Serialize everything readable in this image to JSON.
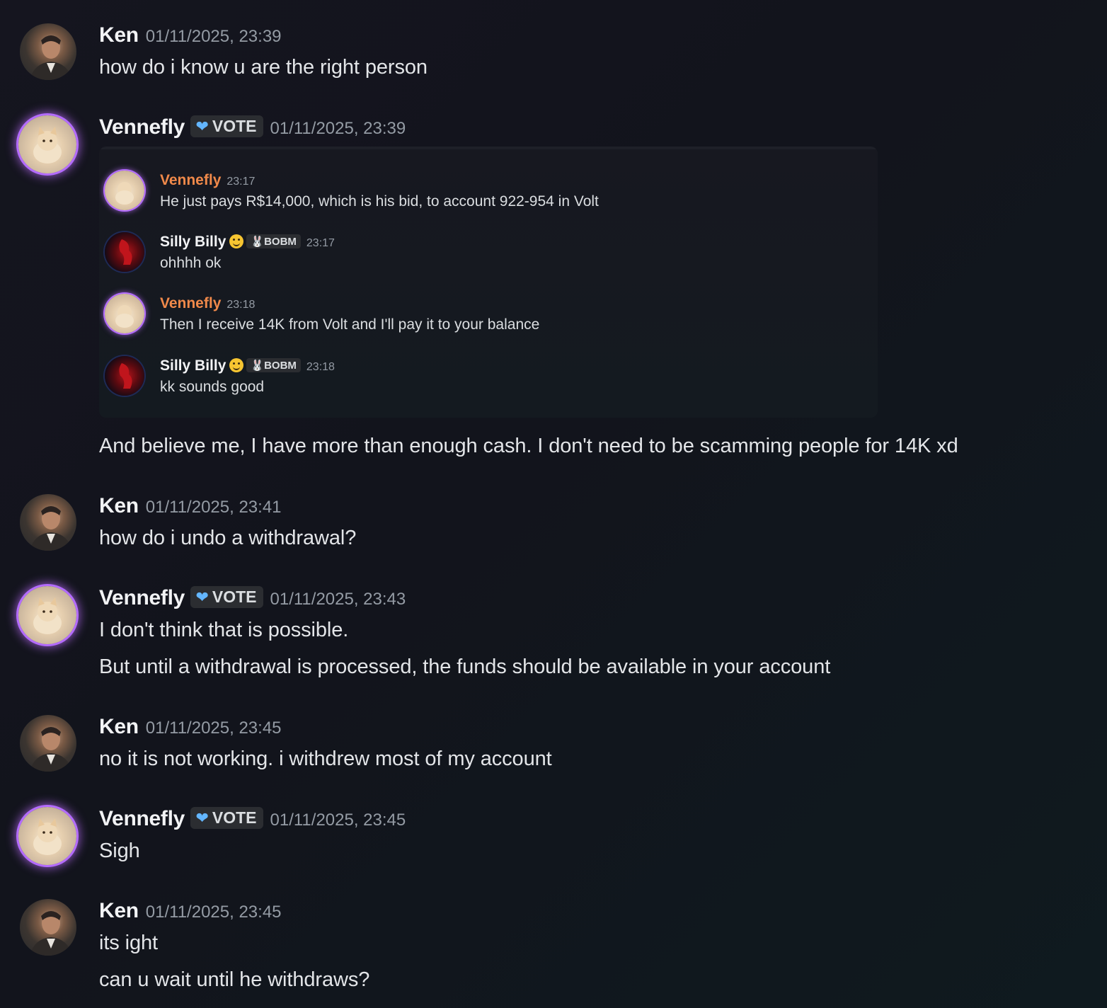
{
  "messages": [
    {
      "author": "Ken",
      "timestamp": "01/11/2025, 23:39",
      "lines": [
        "how do i know u are the right person"
      ]
    },
    {
      "author": "Vennefly",
      "badge": "VOTE",
      "timestamp": "01/11/2025, 23:39",
      "embed": [
        {
          "author": "Vennefly",
          "time": "23:17",
          "text": "He just pays R$14,000, which is his bid, to account 922-954 in Volt"
        },
        {
          "author": "Silly Billy",
          "badge": "BOBM",
          "time": "23:17",
          "text": "ohhhh ok"
        },
        {
          "author": "Vennefly",
          "time": "23:18",
          "text": "Then I receive 14K from Volt and I'll pay it to your balance"
        },
        {
          "author": "Silly Billy",
          "badge": "BOBM",
          "time": "23:18",
          "text": "kk sounds good"
        }
      ],
      "lines": [
        "And believe me, I have more than enough cash. I don't need to be scamming people for 14K xd"
      ]
    },
    {
      "author": "Ken",
      "timestamp": "01/11/2025, 23:41",
      "lines": [
        "how do i undo a withdrawal?"
      ]
    },
    {
      "author": "Vennefly",
      "badge": "VOTE",
      "timestamp": "01/11/2025, 23:43",
      "lines": [
        "I don't think that is possible.",
        "But until a withdrawal is processed, the funds should be available in your account"
      ]
    },
    {
      "author": "Ken",
      "timestamp": "01/11/2025, 23:45",
      "lines": [
        "no it is not working. i withdrew most of my account"
      ]
    },
    {
      "author": "Vennefly",
      "badge": "VOTE",
      "timestamp": "01/11/2025, 23:45",
      "lines": [
        "Sigh"
      ]
    },
    {
      "author": "Ken",
      "timestamp": "01/11/2025, 23:45",
      "lines": [
        "its ight",
        "can u wait until he withdraws?"
      ]
    }
  ],
  "colors": {
    "background": "#15151f",
    "username": "#f2f3f5",
    "timestamp": "#949ba4",
    "embed_orange_name": "#f0894a",
    "avatar_ring": "#b46cff",
    "vote_heart": "#63b6ff"
  },
  "icons": {
    "vote_badge": "blue-heart-icon",
    "bobm_badge": "bunny-icon",
    "billy_emoji": "zany-face-emoji"
  }
}
